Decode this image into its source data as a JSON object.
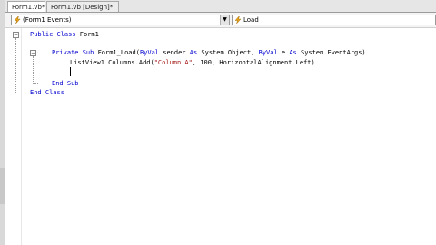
{
  "tabs": [
    {
      "label": "Form1.vb*",
      "close": "",
      "active": true
    },
    {
      "label": "Form1.vb [Design]*",
      "close": "",
      "active": false
    }
  ],
  "nav": {
    "class_selector": {
      "icon": "lightning-icon",
      "value": "(Form1 Events)"
    },
    "method_selector": {
      "icon": "lightning-icon",
      "value": "Load"
    }
  },
  "code": {
    "line1": {
      "kw1": "Public Class",
      "rest": " Form1"
    },
    "line2": {
      "kw1": "Private Sub",
      "rest1": " Form1_Load(",
      "kw2": "ByVal",
      "rest2": " sender ",
      "kw3": "As",
      "rest3": " System.Object, ",
      "kw4": "ByVal",
      "rest4": " e ",
      "kw5": "As",
      "rest5": " System.EventArgs)"
    },
    "line3": {
      "pre": "ListView1.Columns.Add(",
      "str": "\"Column A\"",
      "post": ", 100, HorizontalAlignment.Left)"
    },
    "line4": {
      "kw1": "End Sub"
    },
    "line5": {
      "kw1": "End Class"
    }
  }
}
